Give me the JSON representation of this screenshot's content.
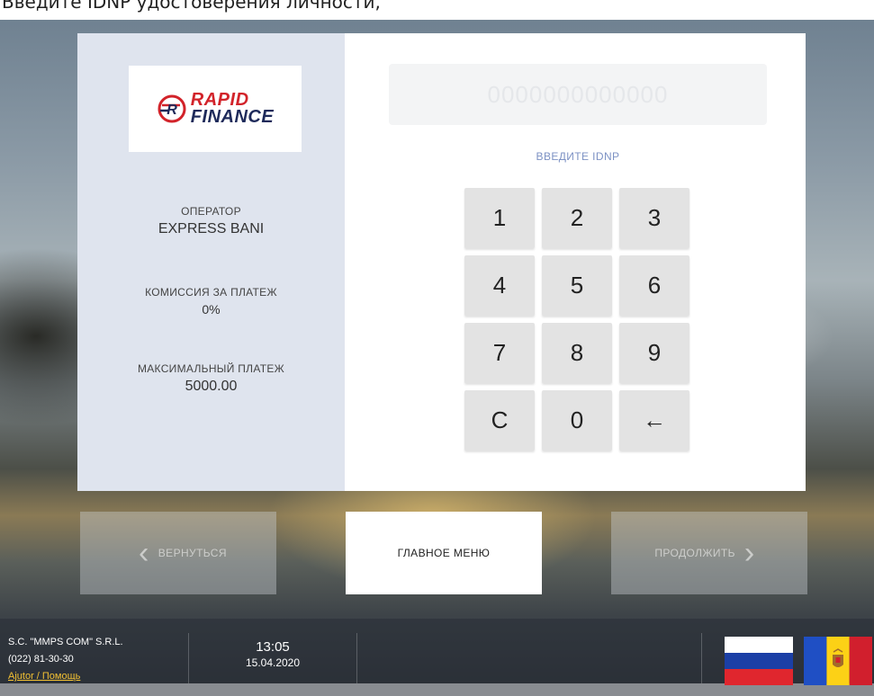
{
  "caption": "Введите IDNP удостоверения личности,",
  "provider": {
    "logo_line1": "RAPID",
    "logo_line2": "FINANCE",
    "operator_label": "ОПЕРАТОР",
    "operator_value": "EXPRESS BANI",
    "fee_label": "КОМИССИЯ ЗА ПЛАТЕЖ",
    "fee_value": "0%",
    "max_label": "МАКСИМАЛЬНЫЙ ПЛАТЕЖ",
    "max_value": "5000.00"
  },
  "input": {
    "placeholder": "0000000000000",
    "hint": "ВВЕДИТЕ IDNP"
  },
  "keypad": {
    "keys": [
      "1",
      "2",
      "3",
      "4",
      "5",
      "6",
      "7",
      "8",
      "9",
      "C",
      "0",
      "←"
    ]
  },
  "nav": {
    "back_label": "ВЕРНУТЬСЯ",
    "main_label": "ГЛАВНОЕ МЕНЮ",
    "next_label": "ПРОДОЛЖИТЬ",
    "back_arrow": "‹",
    "next_arrow": "›"
  },
  "footer": {
    "company": "S.C. \"MMPS COM\" S.R.L.",
    "phone": "(022) 81-30-30",
    "help": "Ajutor / Помощь",
    "time": "13:05",
    "date": "15.04.2020"
  },
  "languages": [
    {
      "code": "ru",
      "icon": "russia-flag-icon"
    },
    {
      "code": "md",
      "icon": "moldova-flag-icon"
    }
  ],
  "colors": {
    "logo_red": "#d2232a",
    "logo_navy": "#1e2a5a",
    "hint_blue": "#7d92c4",
    "help_yellow": "#f3c133",
    "info_panel": "#dfe4ee"
  }
}
